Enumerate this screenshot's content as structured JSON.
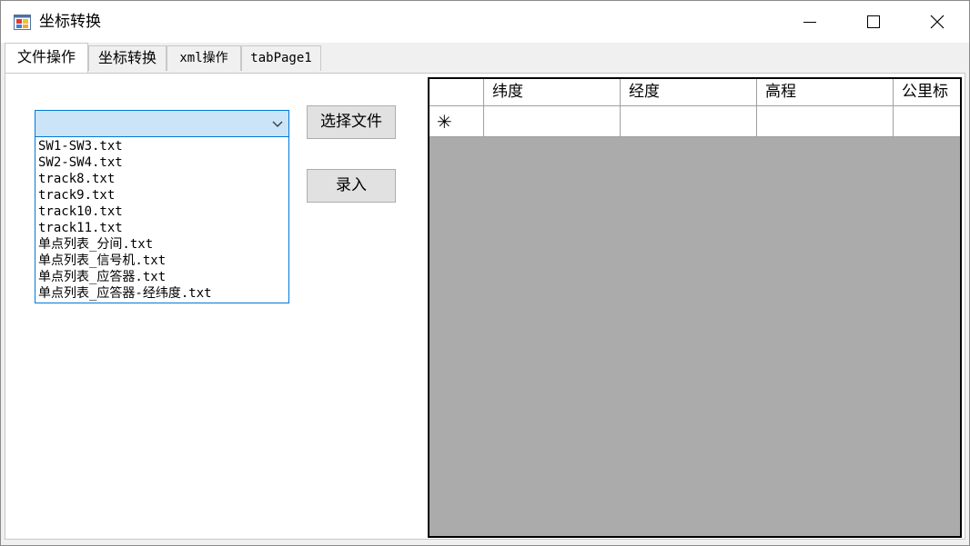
{
  "window": {
    "title": "坐标转换",
    "icon": "windows-forms-app-icon"
  },
  "tabs": [
    {
      "label": "文件操作",
      "active": true
    },
    {
      "label": "坐标转换",
      "active": false
    },
    {
      "label": "xml操作",
      "active": false
    },
    {
      "label": "tabPage1",
      "active": false
    }
  ],
  "file_panel": {
    "combo_value": "",
    "files": [
      "SW1-SW3.txt",
      "SW2-SW4.txt",
      "track8.txt",
      "track9.txt",
      "track10.txt",
      "track11.txt",
      "单点列表_分间.txt",
      "单点列表_信号机.txt",
      "单点列表_应答器.txt",
      "单点列表_应答器-经纬度.txt"
    ],
    "select_file_button": "选择文件",
    "import_button": "录入"
  },
  "grid": {
    "columns": [
      "纬度",
      "经度",
      "高程",
      "公里标"
    ],
    "new_row_marker": "✳",
    "rows": []
  },
  "colors": {
    "accent": "#0078d7",
    "combo_highlight": "#cce4f7",
    "grid_background": "#ababab",
    "button_face": "#e1e1e1"
  }
}
